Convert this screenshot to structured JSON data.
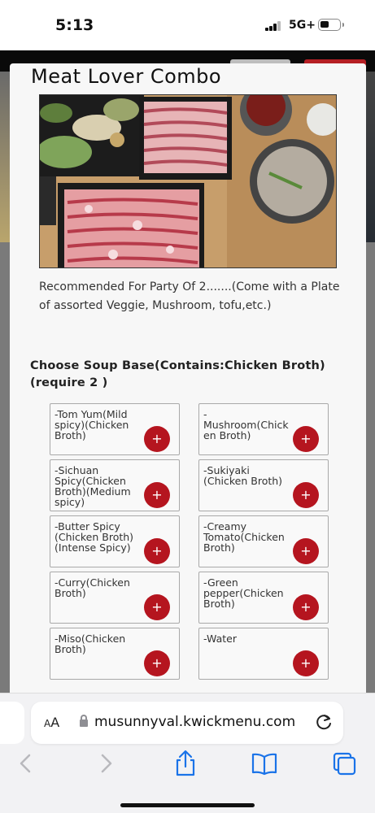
{
  "status_bar": {
    "time": "5:13",
    "network": "5G+",
    "icons": [
      "signal-icon",
      "battery-icon"
    ]
  },
  "modal": {
    "title": "Meat Lover Combo",
    "description": "Recommended For Party Of 2.......(Come with a Plate of assorted Veggie, Mushroom, tofu,etc.)",
    "section_title": "Choose Soup Base(Contains:Chicken Broth) (require 2 )",
    "add_label": "+",
    "add_button_color": "#b5151f",
    "options": [
      {
        "label": "-Tom Yum(Mild spicy)(Chicken Broth)"
      },
      {
        "label": "-Mushroom(Chicken Broth)"
      },
      {
        "label": "-Sichuan Spicy(Chicken Broth)(Medium spicy)"
      },
      {
        "label": "-Sukiyaki (Chicken Broth)"
      },
      {
        "label": "-Butter Spicy (Chicken Broth)(Intense Spicy)"
      },
      {
        "label": "-Creamy Tomato(Chicken Broth)"
      },
      {
        "label": "-Curry(Chicken Broth)"
      },
      {
        "label": "-Green pepper(Chicken Broth)"
      },
      {
        "label": "-Miso(Chicken Broth)"
      },
      {
        "label": "-Water"
      }
    ]
  },
  "browser": {
    "aa_small": "A",
    "aa_large": "A",
    "url": "musunnyval.kwickmenu.com",
    "toolbar_icons": [
      "back-icon",
      "forward-icon",
      "share-icon",
      "bookmarks-icon",
      "tabs-icon"
    ]
  }
}
